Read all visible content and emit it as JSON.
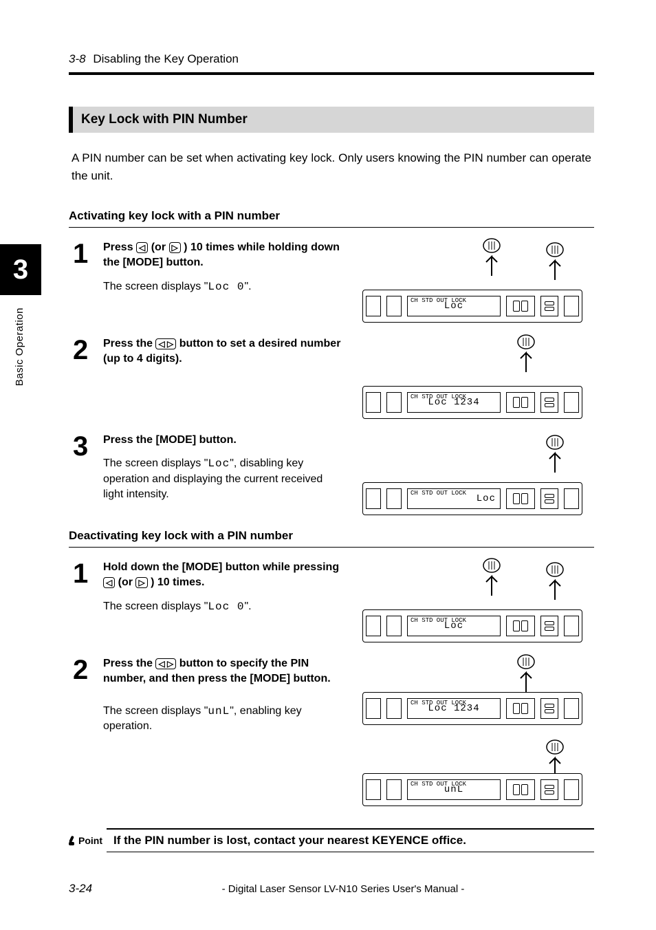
{
  "header": {
    "section_number": "3-8",
    "section_title": "Disabling the Key Operation"
  },
  "side": {
    "chapter_number": "3",
    "chapter_label": "Basic Operation"
  },
  "section_bar": "Key Lock with PIN Number",
  "intro": "A PIN number can be set when activating key lock. Only users knowing the PIN number can operate the unit.",
  "activate": {
    "heading": "Activating key lock with a PIN number",
    "steps": [
      {
        "inst_pre": "Press ",
        "inst_mid": " (or ",
        "inst_post": " ) 10 times while holding down the [MODE] button.",
        "result_pre": "The screen displays \"",
        "result_seg": "Loc  0",
        "result_post": "\".",
        "lcd": "Loc",
        "double_hand": true
      },
      {
        "inst_pre": "Press the ",
        "inst_post": " button to set a desired number (up to 4 digits).",
        "result_pre": "",
        "result_seg": "",
        "result_post": "",
        "lcd": "Loc 1234",
        "double_hand": false
      },
      {
        "inst_plain": "Press the [MODE] button.",
        "result_pre": "The screen displays \"",
        "result_seg": "Loc",
        "result_post": "\", disabling key operation and displaying the current received light intensity.",
        "lcd": "Loc",
        "lcd_right": true,
        "mode_hand": true
      }
    ]
  },
  "deactivate": {
    "heading": "Deactivating key lock with a PIN number",
    "steps": [
      {
        "inst_pre": "Hold down the [MODE] button while pressing ",
        "inst_mid": " (or ",
        "inst_post": " ) 10 times.",
        "result_pre": "The screen displays \"",
        "result_seg": "Loc  0",
        "result_post": "\".",
        "lcd": "Loc",
        "double_hand": true
      },
      {
        "inst_pre": "Press the ",
        "inst_post": " button to specify the PIN number, and then press the [MODE] button.",
        "result_pre": "The screen displays \"",
        "result_seg": "unL",
        "result_post": "\", enabling key operation.",
        "lcd": "Loc 1234",
        "double_hand": false,
        "extra_lcd": "unL"
      }
    ]
  },
  "point": {
    "label": "Point",
    "text": "If the PIN number is lost, contact your nearest KEYENCE office."
  },
  "footer": {
    "page_number": "3-24",
    "manual_title": "- Digital Laser Sensor LV-N10 Series User's Manual -"
  },
  "icons": {
    "left": "◁",
    "right": "▷",
    "both": "◁ ▷"
  }
}
